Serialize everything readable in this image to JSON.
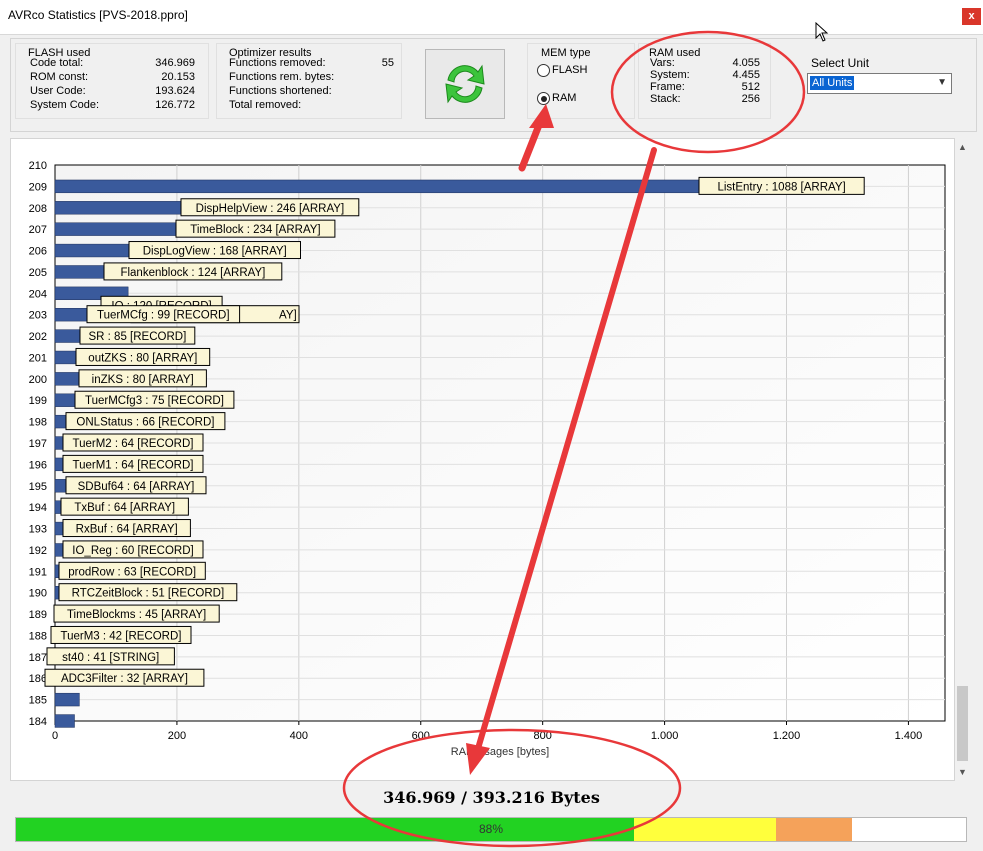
{
  "window": {
    "title": "AVRco Statistics [PVS-2018.ppro]",
    "close_label": "x"
  },
  "flash_used": {
    "title": "FLASH used",
    "rows": [
      {
        "label": "Code total:",
        "value": "346.969"
      },
      {
        "label": "ROM const:",
        "value": "20.153"
      },
      {
        "label": "User Code:",
        "value": "193.624"
      },
      {
        "label": "System Code:",
        "value": "126.772"
      }
    ]
  },
  "optimizer": {
    "title": "Optimizer results",
    "rows": [
      {
        "label": "Functions removed:",
        "value": "55"
      },
      {
        "label": "Functions rem. bytes:",
        "value": ""
      },
      {
        "label": "Functions shortened:",
        "value": ""
      },
      {
        "label": "Total removed:",
        "value": ""
      }
    ]
  },
  "mem_type": {
    "title": "MEM type",
    "options": [
      {
        "label": "FLASH",
        "selected": false
      },
      {
        "label": "RAM",
        "selected": true
      }
    ]
  },
  "ram_used": {
    "title": "RAM used",
    "rows": [
      {
        "label": "Vars:",
        "value": "4.055"
      },
      {
        "label": "System:",
        "value": "4.455"
      },
      {
        "label": "Frame:",
        "value": "512"
      },
      {
        "label": "Stack:",
        "value": "256"
      }
    ]
  },
  "select_unit": {
    "label": "Select Unit",
    "value": "All Units"
  },
  "chart_data": {
    "type": "bar",
    "orientation": "horizontal",
    "xlabel": "RAM usages [bytes]",
    "xlim": [
      0,
      1460
    ],
    "x_ticks": [
      0,
      200,
      400,
      600,
      800,
      1000,
      1200,
      1400
    ],
    "x_tick_labels": [
      "0",
      "200",
      "400",
      "600",
      "800",
      "1.000",
      "1.200",
      "1.400"
    ],
    "y_range": [
      184,
      210
    ],
    "grid": true,
    "bars": [
      {
        "y": 209,
        "value": 1088,
        "label": "ListEntry : 1088 [ARRAY]"
      },
      {
        "y": 208,
        "value": 246,
        "label": "DispHelpView : 246 [ARRAY]"
      },
      {
        "y": 207,
        "value": 234,
        "label": "TimeBlock : 234 [ARRAY]"
      },
      {
        "y": 206,
        "value": 168,
        "label": "DispLogView : 168 [ARRAY]"
      },
      {
        "y": 205,
        "value": 124,
        "label": "Flankenblock : 124 [ARRAY]"
      },
      {
        "y": 204,
        "value": 120,
        "label": "IO : 120 [RECORD]"
      },
      {
        "y": 203,
        "value": 99,
        "label": "TuerMCfg : 99 [RECORD]"
      },
      {
        "y": 202,
        "value": 90,
        "label": "SR : 85 [RECORD]"
      },
      {
        "y": 201,
        "value": 85,
        "label": "outZKS : 80 [ARRAY]"
      },
      {
        "y": 200,
        "value": 80,
        "label": "inZKS : 80 [ARRAY]"
      },
      {
        "y": 199,
        "value": 80,
        "label": "TuerMCfg3 : 75 [RECORD]"
      },
      {
        "y": 198,
        "value": 75,
        "label": "ONLStatus : 66 [RECORD]"
      },
      {
        "y": 197,
        "value": 66,
        "label": "TuerM2 : 64 [RECORD]"
      },
      {
        "y": 196,
        "value": 64,
        "label": "TuerM1 : 64 [RECORD]"
      },
      {
        "y": 195,
        "value": 64,
        "label": "SDBuf64 : 64 [ARRAY]"
      },
      {
        "y": 194,
        "value": 64,
        "label": "TxBuf : 64 [ARRAY]"
      },
      {
        "y": 193,
        "value": 64,
        "label": "RxBuf : 64 [ARRAY]"
      },
      {
        "y": 192,
        "value": 64,
        "label": "IO_Reg : 60 [RECORD]"
      },
      {
        "y": 191,
        "value": 63,
        "label": "prodRow : 63 [RECORD]"
      },
      {
        "y": 190,
        "value": 60,
        "label": "RTCZeitBlock : 51 [RECORD]"
      },
      {
        "y": 189,
        "value": 51,
        "label": "TimeBlockms : 45 [ARRAY]"
      },
      {
        "y": 188,
        "value": 45,
        "label": "TuerM3 : 42 [RECORD]"
      },
      {
        "y": 187,
        "value": 42,
        "label": "st40 : 41 [STRING]"
      },
      {
        "y": 186,
        "value": 41,
        "label": "ADC3Filter : 32 [ARRAY]"
      },
      {
        "y": 185,
        "value": 40,
        "label": ""
      },
      {
        "y": 184,
        "value": 32,
        "label": ""
      }
    ],
    "overlap_label": "M",
    "overlap_label_tail": "AY]"
  },
  "summary": {
    "total": "346.969 / 393.216 Bytes"
  },
  "progress": {
    "percent": 88,
    "label": "88%"
  },
  "colors": {
    "bar": "#3a5a9c",
    "progress_green": "#22d222",
    "progress_yellow": "#ffff3c",
    "progress_orange": "#f5a25a",
    "annotation": "#e8383a"
  }
}
